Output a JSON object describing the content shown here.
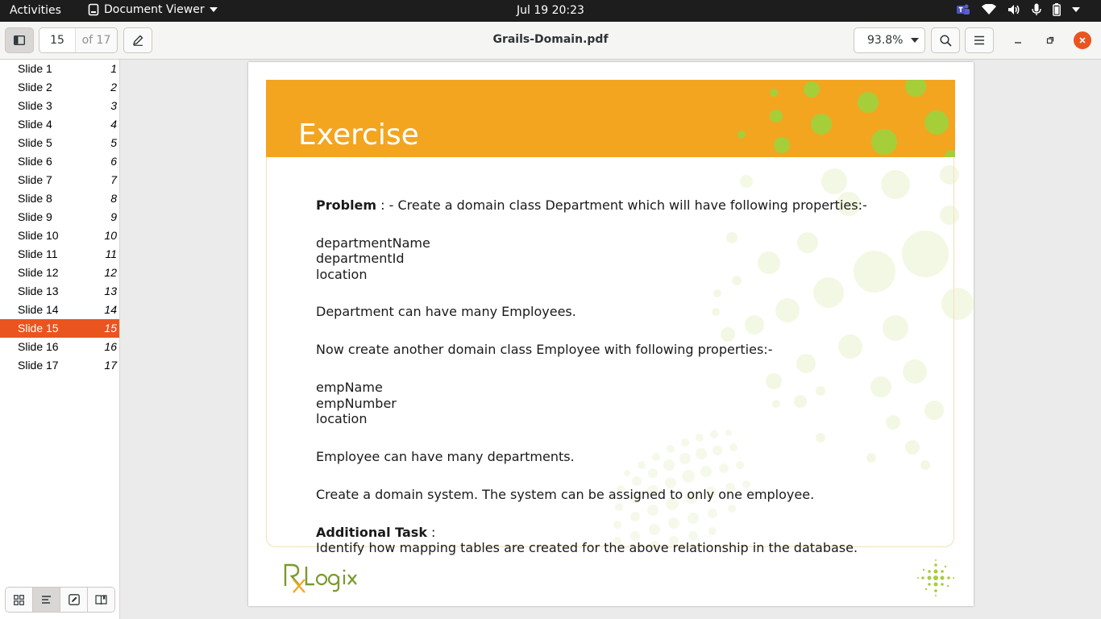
{
  "topbar": {
    "activities": "Activities",
    "app_name": "Document Viewer",
    "clock": "Jul 19  20:23"
  },
  "header": {
    "page_current": "15",
    "page_total": "of 17",
    "document_title": "Grails-Domain.pdf",
    "zoom": "93.8%"
  },
  "sidebar": {
    "items": [
      {
        "label": "Slide 1",
        "num": "1"
      },
      {
        "label": "Slide 2",
        "num": "2"
      },
      {
        "label": "Slide 3",
        "num": "3"
      },
      {
        "label": "Slide 4",
        "num": "4"
      },
      {
        "label": "Slide 5",
        "num": "5"
      },
      {
        "label": "Slide 6",
        "num": "6"
      },
      {
        "label": "Slide 7",
        "num": "7"
      },
      {
        "label": "Slide 8",
        "num": "8"
      },
      {
        "label": "Slide 9",
        "num": "9"
      },
      {
        "label": "Slide 10",
        "num": "10"
      },
      {
        "label": "Slide 11",
        "num": "11"
      },
      {
        "label": "Slide 12",
        "num": "12"
      },
      {
        "label": "Slide 13",
        "num": "13"
      },
      {
        "label": "Slide 14",
        "num": "14"
      },
      {
        "label": "Slide 15",
        "num": "15"
      },
      {
        "label": "Slide 16",
        "num": "16"
      },
      {
        "label": "Slide 17",
        "num": "17"
      }
    ],
    "active_index": 14
  },
  "slide": {
    "title": "Exercise",
    "problem_label": "Problem",
    "problem_text": " : - Create a domain class Department which will have following properties:-",
    "dept_props": [
      "departmentName",
      "departmentId",
      "location"
    ],
    "dept_relation": "Department can have many Employees.",
    "employee_intro": "Now create another domain class Employee with following properties:-",
    "emp_props": [
      "empName",
      "empNumber",
      "location"
    ],
    "emp_relation": "Employee can have many departments.",
    "system_text": "Create a domain system. The system can be assigned to only one employee.",
    "additional_label": "Additional Task",
    "additional_suffix": " :",
    "additional_text": "Identify how mapping tables are created for the above relationship in the database."
  },
  "colors": {
    "banner": "#f3a520",
    "accent_selected": "#e9541f",
    "close_button": "#e9541f",
    "dots_green": "#a6ce39",
    "logo_green": "#7a9a2e",
    "logo_orange": "#f3a520"
  }
}
